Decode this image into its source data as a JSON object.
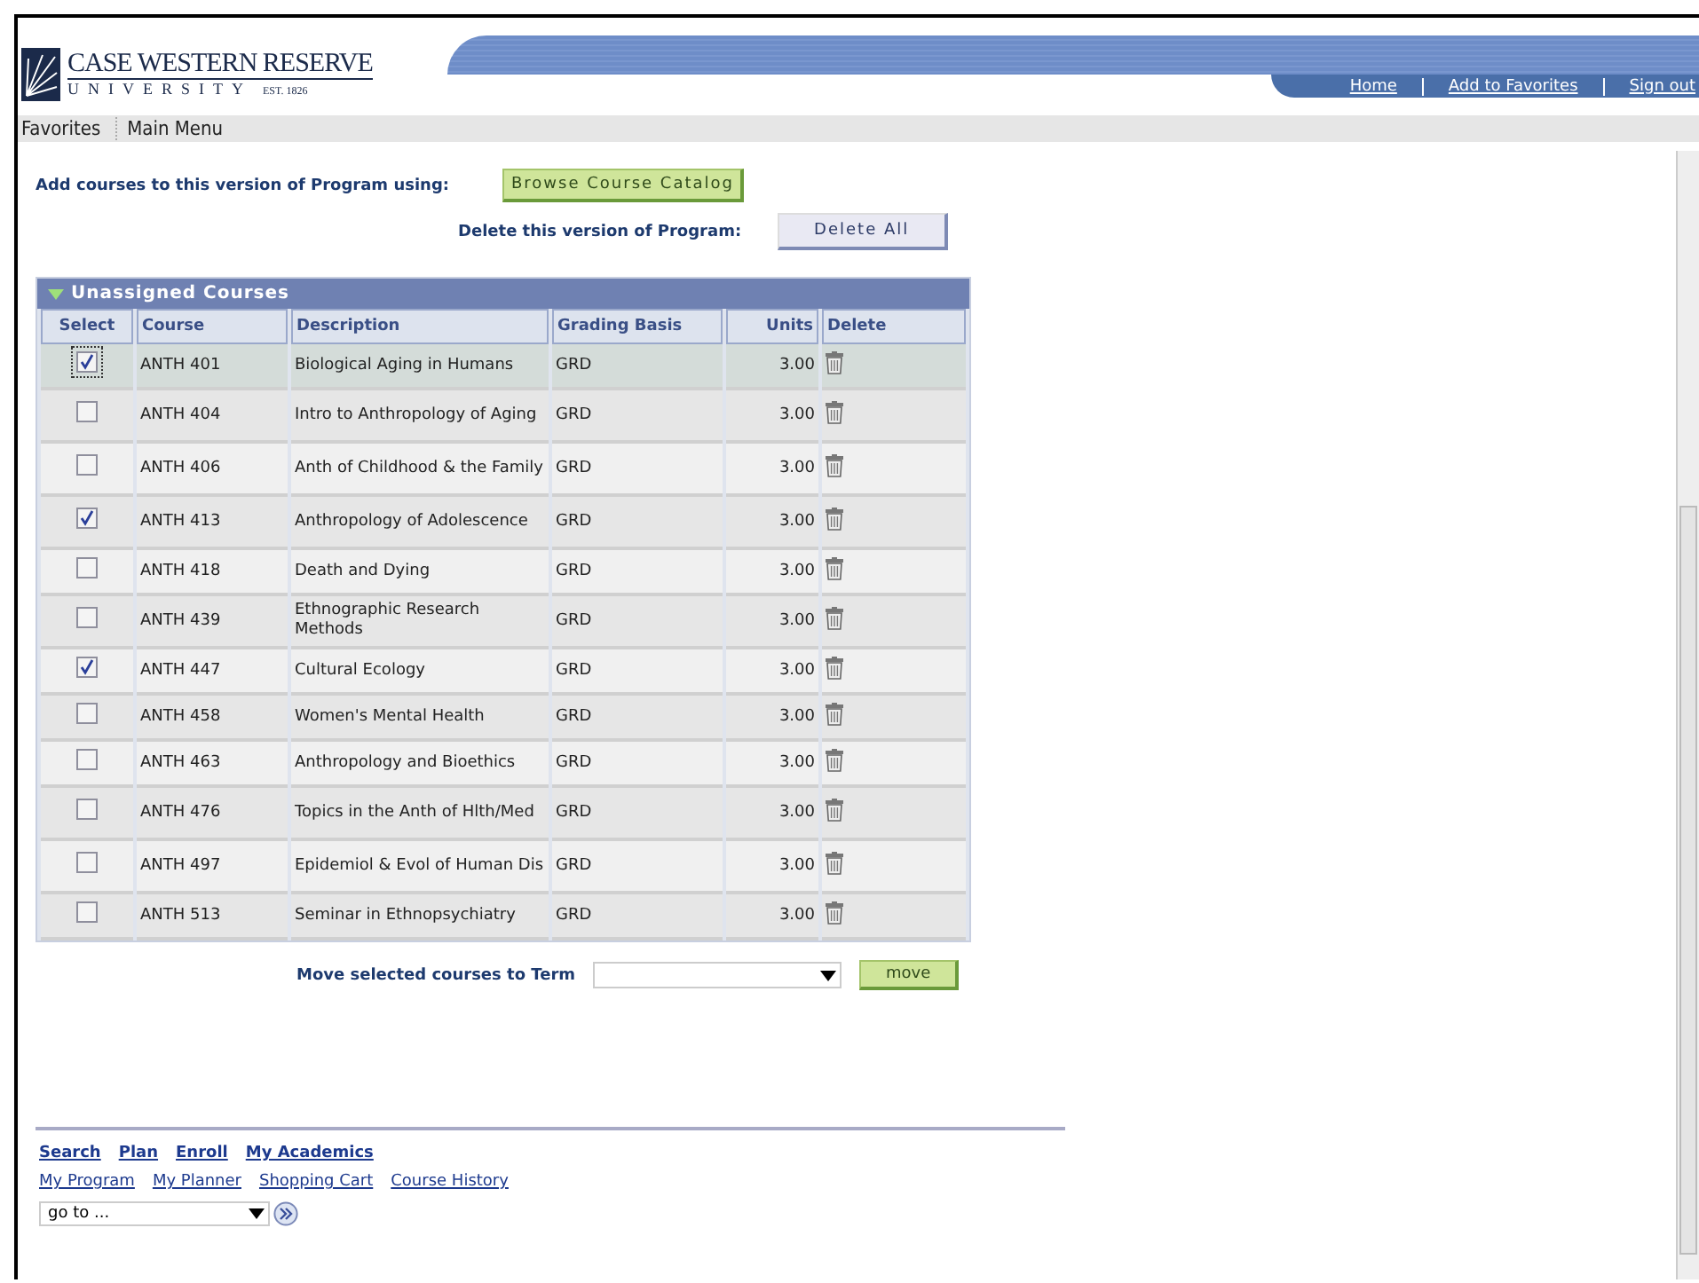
{
  "header": {
    "logo": {
      "name": "CASE WESTERN RESERVE",
      "sub": "UNIVERSITY",
      "est": "EST. 1826"
    },
    "links": [
      "Home",
      "Add to Favorites",
      "Sign out"
    ]
  },
  "menu": [
    "Favorites",
    "Main Menu"
  ],
  "add_label": "Add courses to this version of Program using:",
  "browse_button": "Browse Course Catalog",
  "delete_label": "Delete this version of Program:",
  "delete_all_button": "Delete All",
  "section": {
    "title": "Unassigned Courses",
    "expanded": true
  },
  "table": {
    "columns": [
      "Select",
      "Course",
      "Description",
      "Grading Basis",
      "Units",
      "Delete"
    ],
    "rows": [
      {
        "checked": true,
        "focused": true,
        "course": "ANTH 401",
        "description": "Biological Aging in Humans",
        "grading": "GRD",
        "units": "3.00"
      },
      {
        "checked": false,
        "focused": false,
        "course": "ANTH 404",
        "description": "Intro to Anthropology of Aging",
        "grading": "GRD",
        "units": "3.00"
      },
      {
        "checked": false,
        "focused": false,
        "course": "ANTH 406",
        "description": "Anth of Childhood & the Family",
        "grading": "GRD",
        "units": "3.00"
      },
      {
        "checked": true,
        "focused": false,
        "course": "ANTH 413",
        "description": "Anthropology of Adolescence",
        "grading": "GRD",
        "units": "3.00"
      },
      {
        "checked": false,
        "focused": false,
        "course": "ANTH 418",
        "description": "Death and Dying",
        "grading": "GRD",
        "units": "3.00"
      },
      {
        "checked": false,
        "focused": false,
        "course": "ANTH 439",
        "description": "Ethnographic Research Methods",
        "grading": "GRD",
        "units": "3.00"
      },
      {
        "checked": true,
        "focused": false,
        "course": "ANTH 447",
        "description": "Cultural Ecology",
        "grading": "GRD",
        "units": "3.00"
      },
      {
        "checked": false,
        "focused": false,
        "course": "ANTH 458",
        "description": "Women's Mental Health",
        "grading": "GRD",
        "units": "3.00"
      },
      {
        "checked": false,
        "focused": false,
        "course": "ANTH 463",
        "description": "Anthropology and Bioethics",
        "grading": "GRD",
        "units": "3.00"
      },
      {
        "checked": false,
        "focused": false,
        "course": "ANTH 476",
        "description": "Topics in the Anth of Hlth/Med",
        "grading": "GRD",
        "units": "3.00"
      },
      {
        "checked": false,
        "focused": false,
        "course": "ANTH 497",
        "description": "Epidemiol & Evol of Human Dis",
        "grading": "GRD",
        "units": "3.00"
      },
      {
        "checked": false,
        "focused": false,
        "course": "ANTH 513",
        "description": "Seminar in Ethnopsychiatry",
        "grading": "GRD",
        "units": "3.00"
      }
    ]
  },
  "move": {
    "label": "Move selected courses to Term",
    "button": "move"
  },
  "footer": {
    "primary_links": [
      "Search",
      "Plan",
      "Enroll",
      "My Academics"
    ],
    "secondary_links": [
      "My Program",
      "My Planner",
      "Shopping Cart",
      "Course History"
    ],
    "goto": "go to ..."
  }
}
